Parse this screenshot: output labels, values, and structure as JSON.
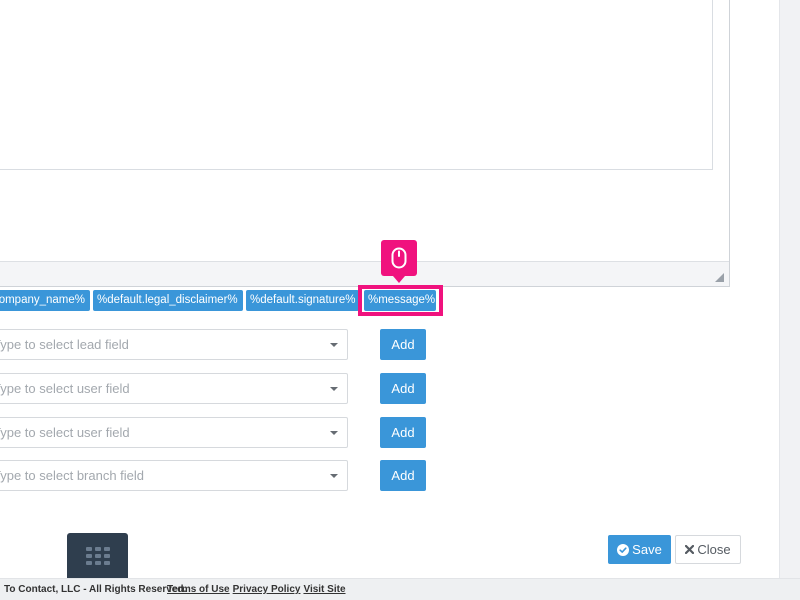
{
  "merge_tags": [
    {
      "label": "%company_name%"
    },
    {
      "label": "%default.legal_disclaimer%"
    },
    {
      "label": "%default.signature%"
    },
    {
      "label": "%message%"
    }
  ],
  "field_rows": [
    {
      "placeholder": "Type to select lead field",
      "add_label": "Add"
    },
    {
      "placeholder": "Type to select user field",
      "add_label": "Add"
    },
    {
      "placeholder": "Type to select user field",
      "add_label": "Add"
    },
    {
      "placeholder": "Type to select branch field",
      "add_label": "Add"
    }
  ],
  "actions": {
    "save_label": "Save",
    "close_label": "Close"
  },
  "footer": {
    "copyright": "To Contact, LLC - All Rights Reserved.",
    "terms_label": "Terms of Use",
    "privacy_label": "Privacy Policy",
    "visit_label": "Visit Site"
  },
  "icons": {
    "cursor": "mouse-icon",
    "apps": "grid-icon",
    "save": "check-circle-icon",
    "close": "close-icon",
    "resize": "resize-handle-icon"
  },
  "colors": {
    "accent": "#3a96d9",
    "highlight": "#f0127e",
    "dark_button": "#2f3e4e"
  }
}
